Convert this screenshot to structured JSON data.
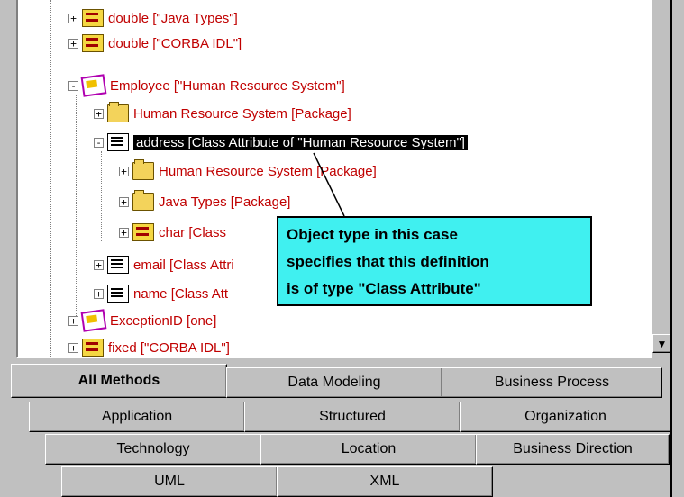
{
  "tree": {
    "rows": [
      {
        "toggle": "+",
        "icon": "class-icon",
        "label": "double [\"Java Types\"]"
      },
      {
        "toggle": "+",
        "icon": "class-icon",
        "label": "double [\"CORBA IDL\"]"
      },
      {
        "toggle": "-",
        "icon": "entity-icon",
        "label": "Employee [\"Human Resource System\"]"
      },
      {
        "toggle": "+",
        "icon": "folder-icon",
        "label": "Human Resource System  [Package]"
      },
      {
        "toggle": "-",
        "icon": "attribute-icon",
        "label": "address  [Class Attribute of \"Human Resource System\"]"
      },
      {
        "toggle": "+",
        "icon": "folder-icon",
        "label": "Human Resource System  [Package]"
      },
      {
        "toggle": "+",
        "icon": "folder-icon",
        "label": "Java Types  [Package]"
      },
      {
        "toggle": "+",
        "icon": "class-icon",
        "label": "char  [Class"
      },
      {
        "toggle": "+",
        "icon": "attribute-icon",
        "label": "email  [Class Attri"
      },
      {
        "toggle": "+",
        "icon": "attribute-icon",
        "label": "name  [Class Att"
      },
      {
        "toggle": "+",
        "icon": "entity-icon",
        "label": "ExceptionID [one]"
      },
      {
        "toggle": "+",
        "icon": "class-icon",
        "label": "fixed [\"CORBA IDL\"]"
      }
    ],
    "scroll_down_glyph": "▼"
  },
  "callout": {
    "lines": [
      "Object type in this case",
      "specifies that this definition",
      "is of type \"Class Attribute\""
    ]
  },
  "tabs": {
    "row1": [
      "All Methods",
      "Data Modeling",
      "Business Process"
    ],
    "row2": [
      "Application",
      "Structured",
      "Organization"
    ],
    "row3": [
      "Technology",
      "Location",
      "Business Direction"
    ],
    "row4": [
      "UML",
      "XML"
    ],
    "active": "All Methods"
  },
  "colors": {
    "label": "#c00000",
    "callout_bg": "#40f0f0",
    "panel": "#c0c0c0"
  }
}
